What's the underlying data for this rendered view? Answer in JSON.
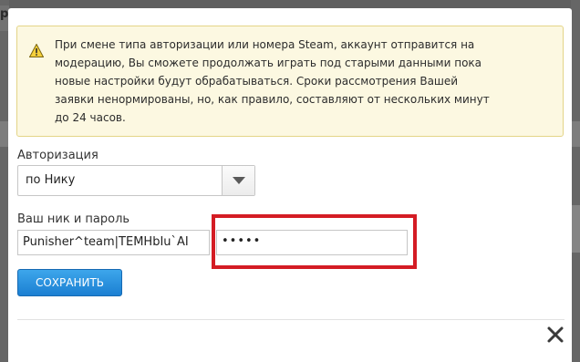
{
  "background": {
    "header_letter": "р"
  },
  "notice": {
    "icon": "warning-icon",
    "lines": [
      "При смене типа авторизации или номера Steam, аккаунт отправится на",
      "модерацию, Вы сможете продолжать играть под старыми данными пока",
      "новые настройки будут обрабатываться. Сроки рассмотрения Вашей",
      "заявки ненормированы, но, как правило, составляют от нескольких минут",
      "до 24 часов."
    ]
  },
  "auth": {
    "label": "Авторизация",
    "selected": "по Нику",
    "dropdown_icon": "caret-down-icon"
  },
  "credentials": {
    "label": "Ваш ник и пароль",
    "nick_value": "Punisher^team|TEMHbIu`AI",
    "password_value": "•••••"
  },
  "save_label": "СОХРАНИТЬ",
  "close_icon": "close-icon",
  "colors": {
    "notice_bg": "#fcf8e1",
    "notice_border": "#e4d588",
    "button_blue": "#2490de",
    "highlight_red": "#d41c24"
  }
}
